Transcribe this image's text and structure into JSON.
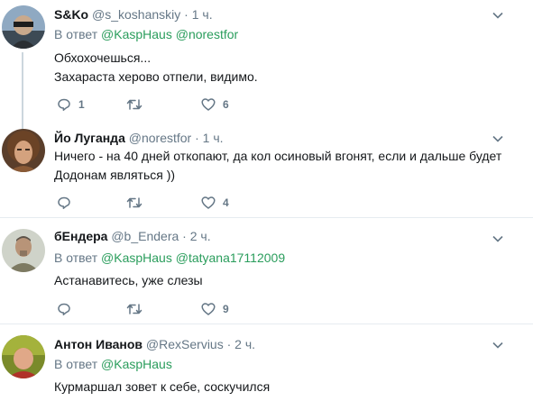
{
  "colors": {
    "name": "#14171a",
    "meta": "#657786",
    "mention": "#2a9d5c",
    "separator": "#e6ecf0",
    "thread_line": "#ccd6dd"
  },
  "tweets": [
    {
      "name": "S&Ko",
      "handle": "@s_koshanskiy",
      "dot": "·",
      "time": "1 ч.",
      "reply_prefix": "В ответ",
      "reply_mentions": "@KaspHaus @norestfor",
      "lines": [
        "Обхохочешься...",
        "Захараста херово отпели, видимо."
      ],
      "replies": "1",
      "retweets": "",
      "likes": "6"
    },
    {
      "name": "Йо Луганда",
      "handle": "@norestfor",
      "dot": "·",
      "time": "1 ч.",
      "lines": [
        "Ничего - на 40 дней откопают, да кол осиновый вгонят, если и дальше будет",
        "Додонам являться ))"
      ],
      "replies": "",
      "retweets": "",
      "likes": "4"
    },
    {
      "name": "бЕндера",
      "handle": "@b_Endera",
      "dot": "·",
      "time": "2 ч.",
      "reply_prefix": "В ответ",
      "reply_mentions": "@KaspHaus @tatyana17112009",
      "lines": [
        "Астанавитесь, уже слезы"
      ],
      "replies": "",
      "retweets": "",
      "likes": "9"
    },
    {
      "name": "Антон Иванов",
      "handle": "@RexServius",
      "dot": "·",
      "time": "2 ч.",
      "reply_prefix": "В ответ",
      "reply_mentions": "@KaspHaus",
      "lines": [
        "Курмаршал зовет к себе, соскучился"
      ]
    }
  ]
}
